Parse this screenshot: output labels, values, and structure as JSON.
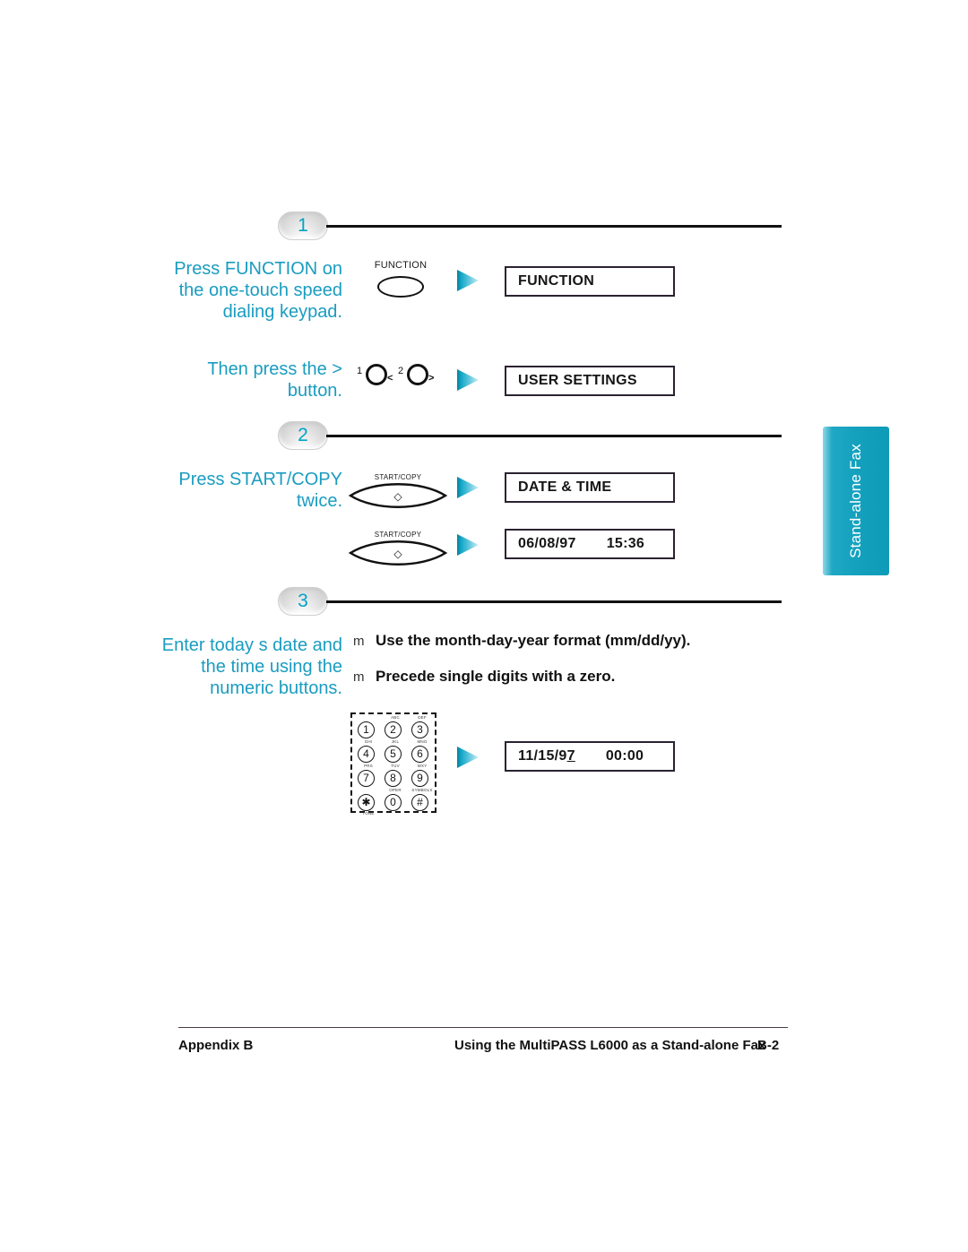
{
  "side_tab": {
    "label": "Stand-alone Fax",
    "color": "#12a0bd"
  },
  "accent_color": "#1a9cc0",
  "steps": [
    {
      "number": "1",
      "instructions": [
        "Press FUNCTION on the one-touch speed dialing keypad.",
        "Then press the > button."
      ],
      "rows": [
        {
          "button_caption": "FUNCTION",
          "button_kind": "ellipse",
          "arrow": "right-arrow",
          "lcd": "FUNCTION"
        },
        {
          "button_caption": "",
          "button_kind": "arrow-keys",
          "key_one_label": "1",
          "key_one_dir": "<",
          "key_two_label": "2",
          "key_two_dir": ">",
          "arrow": "right-arrow",
          "lcd": "USER SETTINGS"
        }
      ]
    },
    {
      "number": "2",
      "instructions": [
        "Press START/COPY twice."
      ],
      "rows": [
        {
          "button_caption": "START/COPY",
          "button_kind": "lens",
          "arrow": "right-arrow",
          "lcd": "DATE & TIME"
        },
        {
          "button_caption": "START/COPY",
          "button_kind": "lens",
          "arrow": "right-arrow",
          "lcd_date": "06/08/97",
          "lcd_time": "15:36"
        }
      ]
    },
    {
      "number": "3",
      "instructions": [
        "Enter today s date and the time using the numeric buttons."
      ],
      "notes": [
        {
          "mark": "m",
          "text": "Use the month-day-year format (mm/dd/yy)."
        },
        {
          "mark": "m",
          "text": "Precede single digits with a zero."
        }
      ],
      "rows": [
        {
          "button_kind": "keypad",
          "arrow": "right-arrow",
          "lcd_date_prefix": "11/15/9",
          "lcd_date_cursor": "7",
          "lcd_time": "00:00"
        }
      ]
    }
  ],
  "keypad": {
    "keys": [
      {
        "digit": "1",
        "letters": ""
      },
      {
        "digit": "2",
        "letters": "ABC"
      },
      {
        "digit": "3",
        "letters": "DEF"
      },
      {
        "digit": "4",
        "letters": "GHI"
      },
      {
        "digit": "5",
        "letters": "JKL"
      },
      {
        "digit": "6",
        "letters": "MNO"
      },
      {
        "digit": "7",
        "letters": "PRS"
      },
      {
        "digit": "8",
        "letters": "TUV"
      },
      {
        "digit": "9",
        "letters": "WXY"
      },
      {
        "digit": "✱",
        "letters": ""
      },
      {
        "digit": "0",
        "letters": "OPER"
      },
      {
        "digit": "#",
        "letters": "SYMBOLS"
      }
    ],
    "tone_label": "TONE"
  },
  "footer": {
    "left": "Appendix B",
    "center": "Using the MultiPASS L6000 as a Stand-alone Fax",
    "page": "B-2"
  }
}
